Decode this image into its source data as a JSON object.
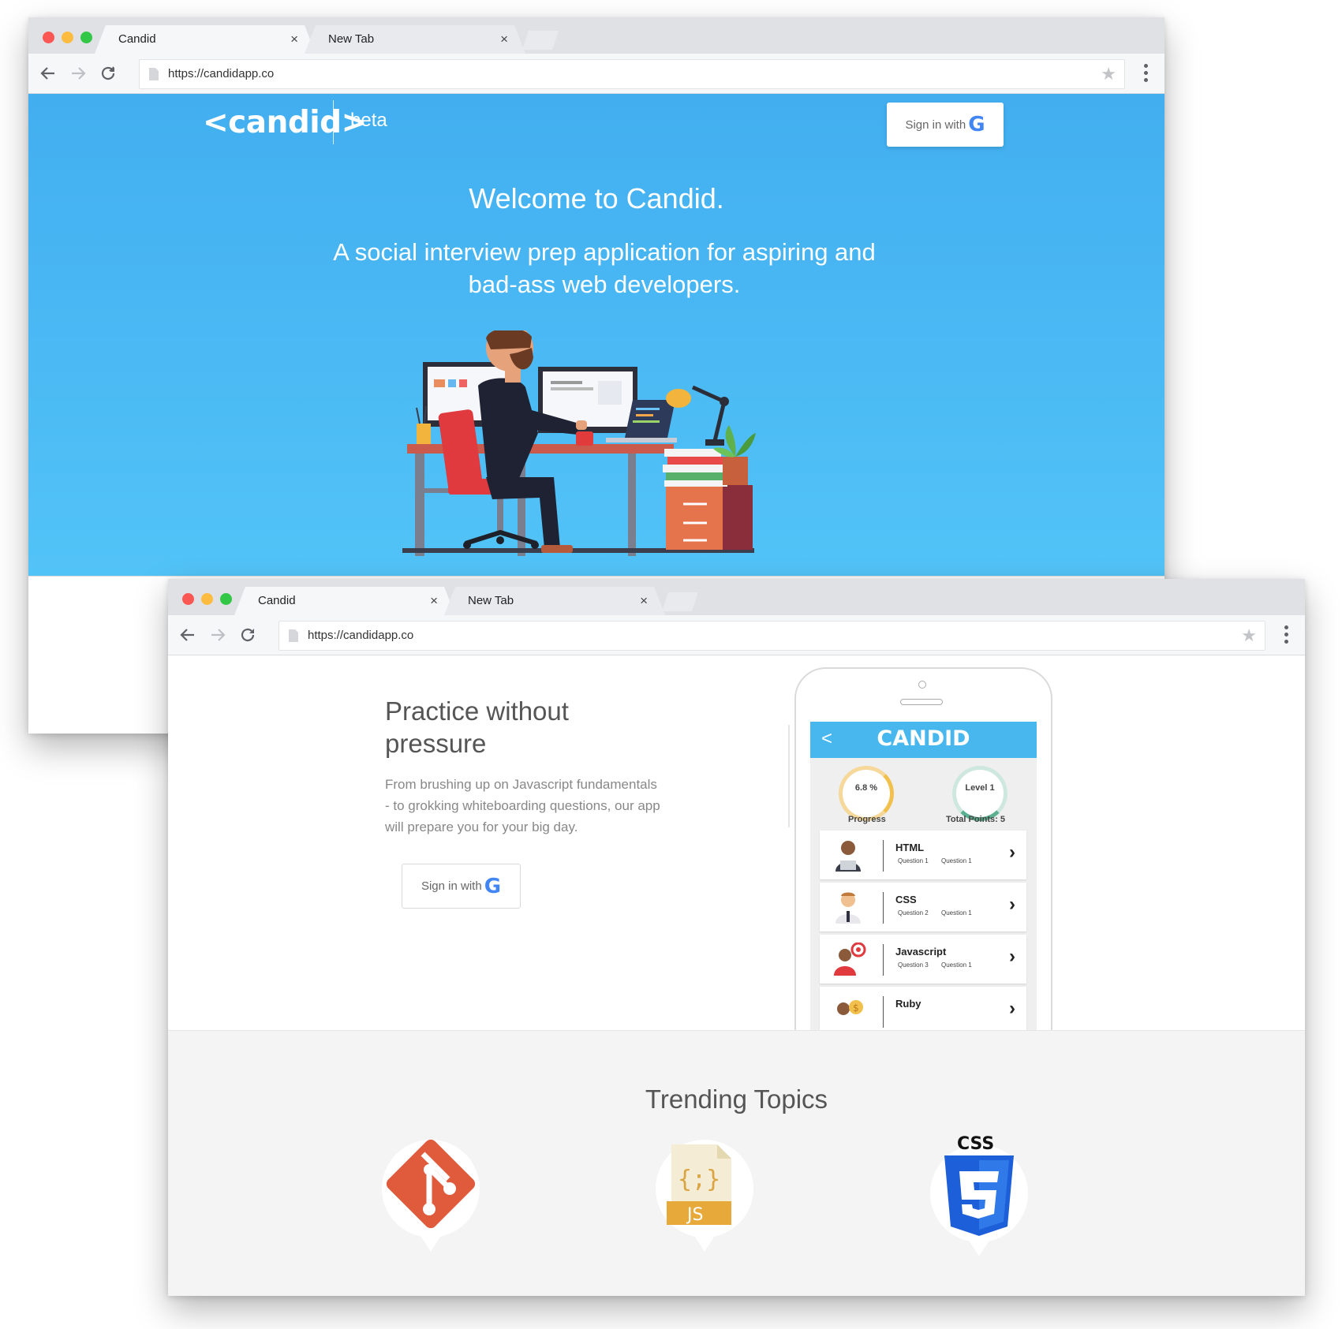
{
  "window1": {
    "tabs": [
      {
        "title": "Candid",
        "close": "×"
      },
      {
        "title": "New Tab",
        "close": "×"
      }
    ],
    "url": "https://candidapp.co",
    "hero": {
      "logo": "<candid>",
      "beta": "beta",
      "signin_label": "Sign in with",
      "signin_logo": "G",
      "title": "Welcome to Candid.",
      "subtitle": "A social interview prep application for aspiring and bad-ass web developers."
    }
  },
  "window2": {
    "tabs": [
      {
        "title": "Candid",
        "close": "×"
      },
      {
        "title": "New Tab",
        "close": "×"
      }
    ],
    "url": "https://candidapp.co",
    "feature": {
      "title": "Practice without pressure",
      "body": "From brushing up on Javascript fundamentals - to grokking whiteboarding questions, our app will prepare you for your big day.",
      "signin_label": "Sign in with",
      "signin_logo": "G"
    },
    "phone_app": {
      "back": "<",
      "logo": "CANDID",
      "progress_value": "6.8 %",
      "progress_label": "Progress",
      "level_value": "Level 1",
      "points_label": "Total Points: 5",
      "topics": [
        {
          "name": "HTML",
          "q1": "Question 1",
          "q2": "Question 1"
        },
        {
          "name": "CSS",
          "q1": "Question 2",
          "q2": "Question 1"
        },
        {
          "name": "Javascript",
          "q1": "Question 3",
          "q2": "Question 1"
        },
        {
          "name": "Ruby",
          "q1": "",
          "q2": ""
        }
      ],
      "chevron": "›"
    },
    "trending": {
      "title": "Trending Topics",
      "icons": [
        "git-icon",
        "javascript-icon",
        "css3-icon"
      ],
      "js_file_label": "{;}",
      "js_badge": "JS",
      "css_label": "CSS"
    }
  },
  "colors": {
    "hero_blue": "#42aef0",
    "app_bar_blue": "#48b7ee",
    "git_orange": "#e05a3c",
    "css_blue": "#1d5fd8"
  }
}
